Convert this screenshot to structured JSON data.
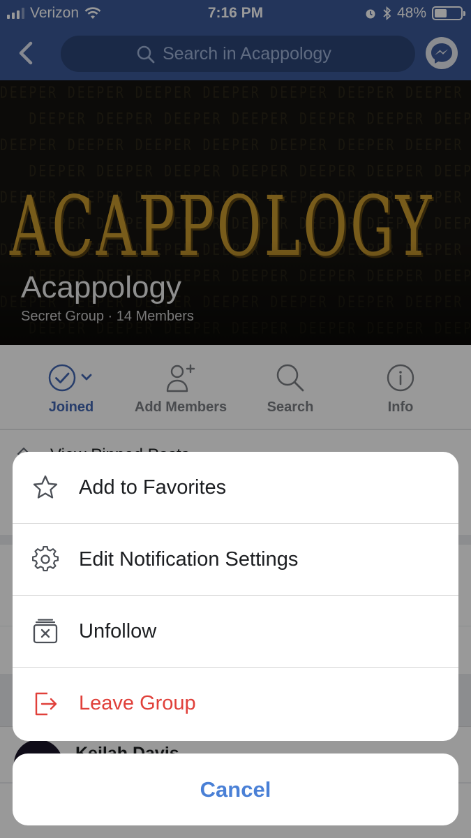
{
  "status_bar": {
    "carrier": "Verizon",
    "time": "7:16 PM",
    "battery": "48%",
    "battery_level": 0.48
  },
  "nav": {
    "search_placeholder": "Search in Acappology"
  },
  "cover": {
    "logo_text": "ACAPPOLOGY",
    "pattern_word": "DEEPER",
    "group_name": "Acappology",
    "group_meta": "Secret Group · 14 Members"
  },
  "actions": [
    {
      "label": "Joined",
      "icon": "check-circle-icon"
    },
    {
      "label": "Add Members",
      "icon": "add-person-icon"
    },
    {
      "label": "Search",
      "icon": "search-icon"
    },
    {
      "label": "Info",
      "icon": "info-icon"
    }
  ],
  "background_rows": {
    "pinned_posts": "View Pinned Posts",
    "member_name": "Keilah Davis"
  },
  "sheet": {
    "items": [
      {
        "label": "Add to Favorites",
        "icon": "star-icon"
      },
      {
        "label": "Edit Notification Settings",
        "icon": "gear-icon"
      },
      {
        "label": "Unfollow",
        "icon": "unfollow-icon"
      },
      {
        "label": "Leave Group",
        "icon": "leave-icon"
      }
    ],
    "cancel": "Cancel"
  },
  "colors": {
    "nav_blue": "#3b5998",
    "joined_blue": "#4267b2",
    "danger_red": "#e0403a",
    "cancel_blue": "#4a80d6",
    "logo_gold": "#c9992e"
  }
}
